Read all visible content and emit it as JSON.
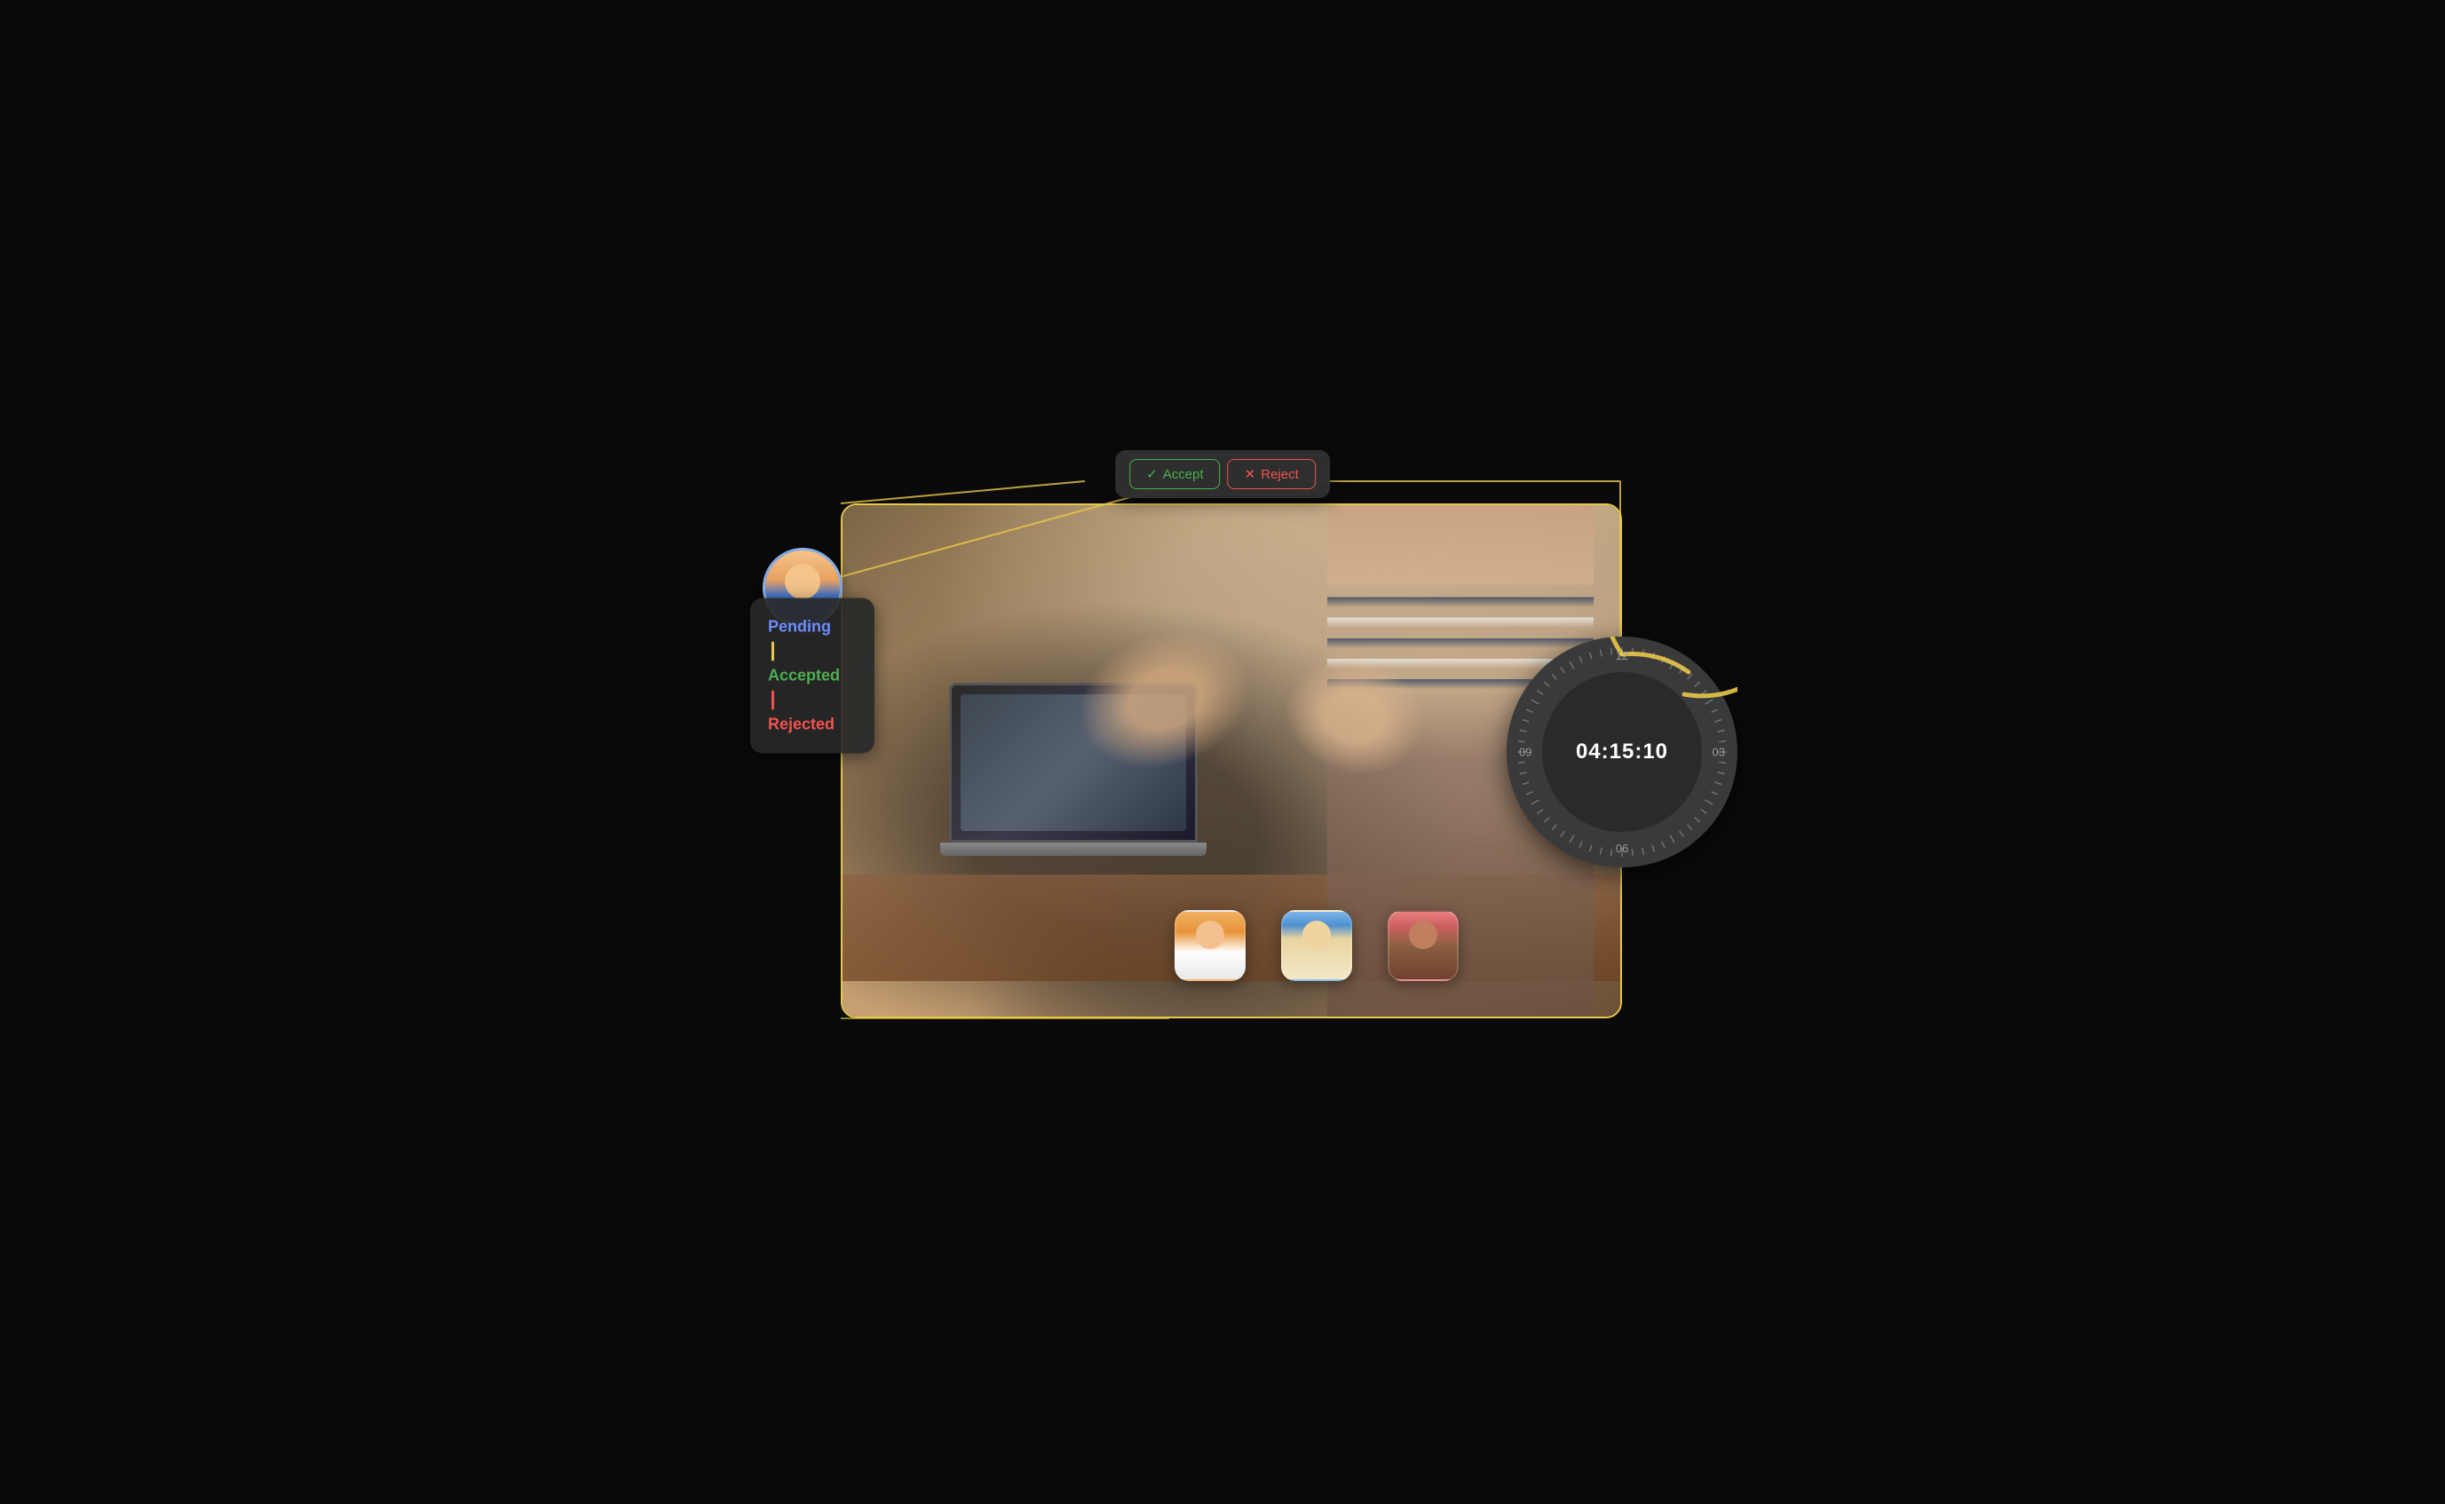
{
  "toolbar": {
    "accept_label": "Accept",
    "reject_label": "Reject",
    "accept_icon": "✓",
    "reject_icon": "✕"
  },
  "status_panel": {
    "pending_label": "Pending",
    "accepted_label": "Accepted",
    "rejected_label": "Rejected"
  },
  "clock": {
    "time": "04:15:10",
    "label_12": "12",
    "label_03": "03",
    "label_06": "06",
    "label_09": "09"
  },
  "colors": {
    "border_gold": "#e8c84a",
    "accept_green": "#4caf50",
    "reject_red": "#ef5350",
    "pending_blue": "#6b8cff",
    "clock_bg": "#3a3a3a",
    "panel_bg": "rgba(40,40,40,0.92)"
  },
  "avatars": {
    "main": {
      "description": "male professional"
    },
    "bottom": [
      {
        "id": "avatar-woman-1",
        "bg": "orange",
        "description": "woman with brown hair"
      },
      {
        "id": "avatar-woman-2",
        "bg": "blue",
        "description": "woman with blonde hair"
      },
      {
        "id": "avatar-man-1",
        "bg": "pink",
        "description": "man smiling"
      }
    ]
  }
}
